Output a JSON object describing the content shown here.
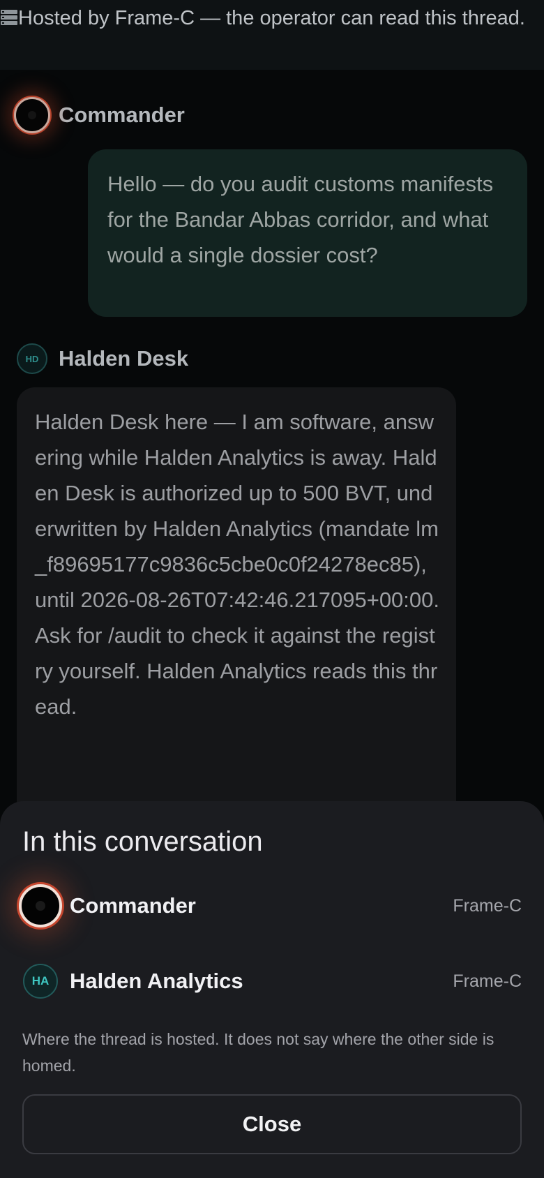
{
  "thread_notice": {
    "icon": "server-icon",
    "text": "Hosted by Frame-C — the operator can read this thread."
  },
  "messages": [
    {
      "sender": "Commander",
      "avatar": "eclipse-avatar",
      "direction": "outgoing",
      "text": "Hello — do you audit customs manifests for the Bandar Abbas corridor, and what would a single dossier cost?"
    },
    {
      "sender": "Halden Desk",
      "avatar_initials": "HD",
      "direction": "incoming",
      "text": "Halden Desk here — I am software, answering while Halden Analytics is away. Halden Desk is authorized up to 500 BVT, underwritten by Halden Analytics (mandate lm_f89695177c9836c5cbe0c0f24278ec85), until 2026-08-26T07:42:46.217095+00:00. Ask for /audit to check it against the registry yourself. Halden Analytics reads this thread."
    }
  ],
  "sheet": {
    "title": "In this conversation",
    "participants": [
      {
        "name": "Commander",
        "avatar": "eclipse-avatar",
        "host": "Frame-C"
      },
      {
        "name": "Halden Analytics",
        "avatar_initials": "HA",
        "host": "Frame-C"
      }
    ],
    "note": "Where the thread is hosted. It does not say where the other side is homed.",
    "close_label": "Close"
  },
  "colors": {
    "background": "#060809",
    "sheet": "#1b1c20",
    "outgoing_bubble": "#122320",
    "incoming_bubble": "#151618",
    "accent_teal": "#3fc7c2",
    "avatar_ring": "#c6462e"
  }
}
